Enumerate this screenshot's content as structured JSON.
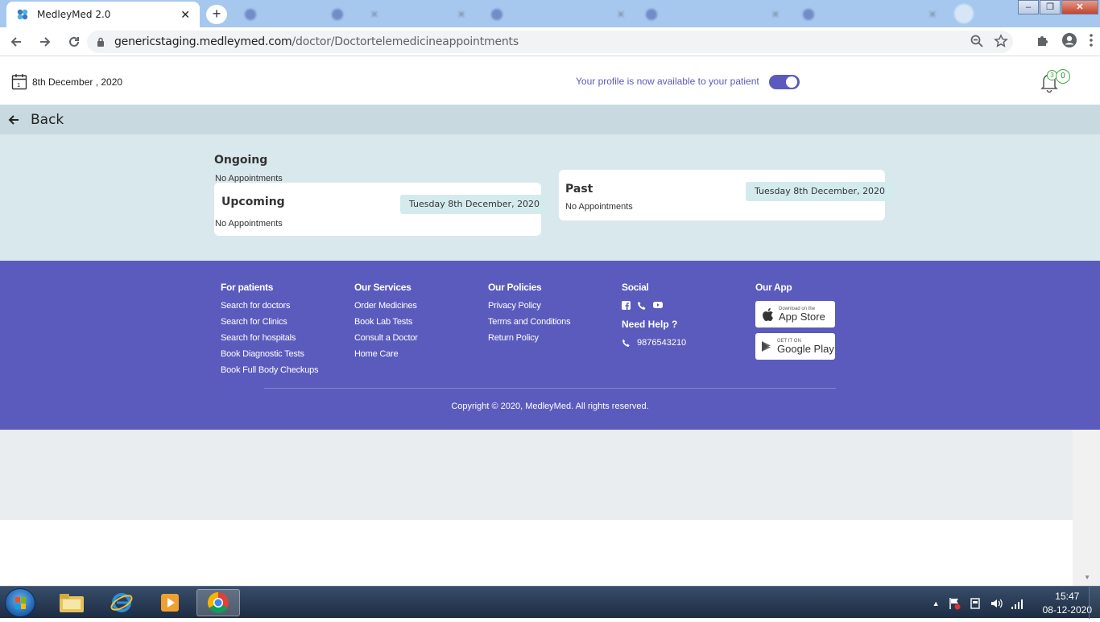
{
  "browser": {
    "active_tab_title": "MedleyMed 2.0",
    "url_host": "genericstaging.medleymed.com",
    "url_path": "/doctor/Doctortelemedicineappointments"
  },
  "header": {
    "date": "8th December , 2020",
    "availability_text": "Your profile is now available to your patient",
    "availability_on": true,
    "notification_count": "0",
    "notification_count_small": "3"
  },
  "nav": {
    "back_label": "Back"
  },
  "appointments": {
    "ongoing": {
      "title": "Ongoing",
      "empty": "No Appointments"
    },
    "upcoming": {
      "title": "Upcoming",
      "date": "Tuesday 8th December, 2020",
      "empty": "No Appointments"
    },
    "past": {
      "title": "Past",
      "date": "Tuesday 8th December, 2020",
      "empty": "No Appointments"
    }
  },
  "footer": {
    "patients": {
      "heading": "For patients",
      "links": [
        "Search for doctors",
        "Search for Clinics",
        "Search for hospitals",
        "Book Diagnostic Tests",
        "Book Full Body Checkups"
      ]
    },
    "services": {
      "heading": "Our Services",
      "links": [
        "Order Medicines",
        "Book Lab Tests",
        "Consult a Doctor",
        "Home Care"
      ]
    },
    "policies": {
      "heading": "Our Policies",
      "links": [
        "Privacy Policy",
        "Terms and Conditions",
        "Return Policy"
      ]
    },
    "social": {
      "heading": "Social",
      "icons": [
        "facebook-icon",
        "phone-icon",
        "youtube-icon"
      ],
      "need_help": "Need Help ?",
      "phone": "9876543210"
    },
    "app": {
      "heading": "Our App",
      "appstore_small": "Download on the",
      "appstore_large": "App Store",
      "googleplay_small": "GET IT ON",
      "googleplay_large": "Google Play"
    },
    "copyright": "Copyright © 2020, MedleyMed. All rights reserved."
  },
  "taskbar": {
    "time": "15:47",
    "date": "08-12-2020"
  },
  "colors": {
    "brand": "#5b5bbd",
    "page_bg": "#d9e8ec",
    "pill_bg": "#d4ebee"
  }
}
